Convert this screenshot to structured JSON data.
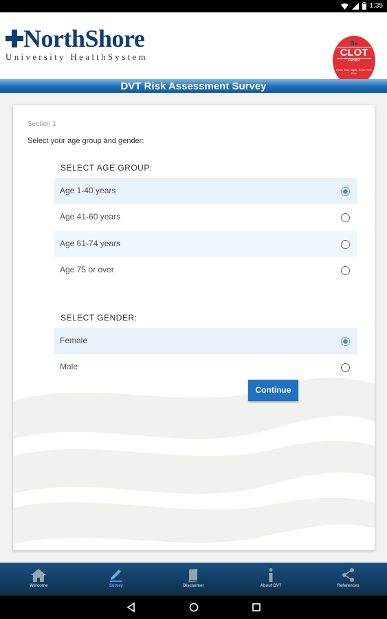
{
  "status_bar": {
    "time": "1:35"
  },
  "header": {
    "logo_name": "NorthShore",
    "logo_subtitle": "University HealthSystem",
    "badge": {
      "line1": "Be",
      "line2": "CLOT",
      "line3": "Aware",
      "line4": "Know Your Signs, Know Your Risk"
    }
  },
  "title_bar": {
    "title": "DVT Risk Assessment Survey"
  },
  "survey": {
    "section_label": "Section 1",
    "prompt": "Select your age group and gender:",
    "age_group": {
      "title": "SELECT AGE GROUP:",
      "options": [
        {
          "label": "Age 1-40 years",
          "selected": true
        },
        {
          "label": "Age 41-60 years",
          "selected": false
        },
        {
          "label": "Age 61-74 years",
          "selected": false
        },
        {
          "label": "Age 75 or over",
          "selected": false
        }
      ]
    },
    "gender": {
      "title": "SELECT GENDER:",
      "options": [
        {
          "label": "Female",
          "selected": true
        },
        {
          "label": "Male",
          "selected": false
        }
      ]
    },
    "continue_label": "Continue"
  },
  "bottom_nav": {
    "items": [
      {
        "label": "Welcome",
        "icon": "home-icon",
        "active": false
      },
      {
        "label": "Survey",
        "icon": "pencil-icon",
        "active": true
      },
      {
        "label": "Disclaimer",
        "icon": "book-icon",
        "active": false
      },
      {
        "label": "About DVT",
        "icon": "info-icon",
        "active": false
      },
      {
        "label": "References",
        "icon": "share-icon",
        "active": false
      }
    ]
  },
  "colors": {
    "brand_navy": "#0e3c73",
    "accent_blue": "#1f72c2",
    "radio_selected": "#4a8fd6",
    "badge_red": "#e33036"
  }
}
